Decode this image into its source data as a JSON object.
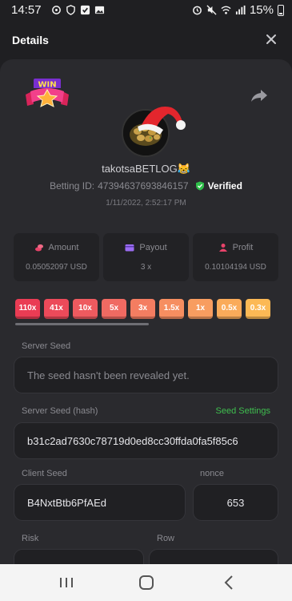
{
  "status_bar": {
    "time": "14:57",
    "battery": "15%"
  },
  "header": {
    "title": "Details"
  },
  "bet": {
    "username": "takotsaBETLOG😹",
    "betting_id_label": "Betting ID:",
    "betting_id": "473946376938461​57",
    "verified": "Verified",
    "timestamp": "1/11/2022, 2:52:17 PM"
  },
  "stats": [
    {
      "label": "Amount",
      "value": "0.05052097 USD",
      "icon": "coins-icon",
      "color": "#e8436a"
    },
    {
      "label": "Payout",
      "value": "3 x",
      "icon": "wallet-icon",
      "color": "#9b6cf2"
    },
    {
      "label": "Profit",
      "value": "0.10104194 USD",
      "icon": "profit-icon",
      "color": "#e8436a"
    }
  ],
  "multipliers": [
    {
      "label": "110x",
      "color": "#ea3c54"
    },
    {
      "label": "41x",
      "color": "#ec4a5a"
    },
    {
      "label": "10x",
      "color": "#ee5a5f"
    },
    {
      "label": "5x",
      "color": "#f06a62"
    },
    {
      "label": "3x",
      "color": "#f47d61"
    },
    {
      "label": "1.5x",
      "color": "#f68e60"
    },
    {
      "label": "1x",
      "color": "#f89d60"
    },
    {
      "label": "0.5x",
      "color": "#faab5a"
    },
    {
      "label": "0.3x",
      "color": "#fcb955"
    }
  ],
  "server_seed": {
    "label": "Server Seed",
    "value": "The seed hasn't been revealed yet."
  },
  "server_seed_hash": {
    "label": "Server Seed (hash)",
    "value": "b31c2ad7630c78719d0ed8cc30ffda0fa5f85c6",
    "settings_link": "Seed Settings"
  },
  "client_seed": {
    "label": "Client Seed",
    "value": "B4NxtBtb6PfAEd"
  },
  "nonce": {
    "label": "nonce",
    "value": "653"
  },
  "risk": {
    "label": "Risk"
  },
  "row": {
    "label": "Row"
  },
  "colors": {
    "background": "#1f1f22",
    "card": "#2a2a2e",
    "accent_green": "#3fbf4f"
  }
}
